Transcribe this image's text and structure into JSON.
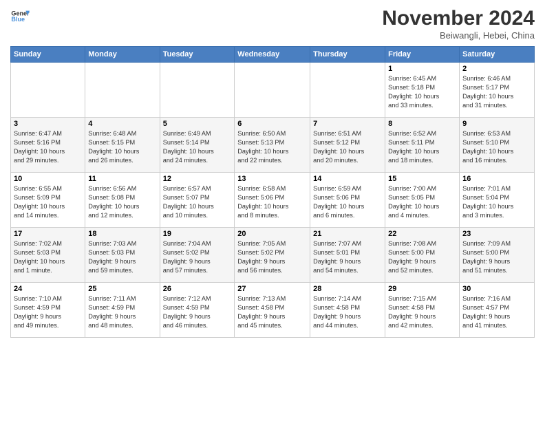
{
  "logo": {
    "line1": "General",
    "line2": "Blue"
  },
  "title": "November 2024",
  "location": "Beiwangli, Hebei, China",
  "weekdays": [
    "Sunday",
    "Monday",
    "Tuesday",
    "Wednesday",
    "Thursday",
    "Friday",
    "Saturday"
  ],
  "weeks": [
    [
      {
        "day": "",
        "info": ""
      },
      {
        "day": "",
        "info": ""
      },
      {
        "day": "",
        "info": ""
      },
      {
        "day": "",
        "info": ""
      },
      {
        "day": "",
        "info": ""
      },
      {
        "day": "1",
        "info": "Sunrise: 6:45 AM\nSunset: 5:18 PM\nDaylight: 10 hours\nand 33 minutes."
      },
      {
        "day": "2",
        "info": "Sunrise: 6:46 AM\nSunset: 5:17 PM\nDaylight: 10 hours\nand 31 minutes."
      }
    ],
    [
      {
        "day": "3",
        "info": "Sunrise: 6:47 AM\nSunset: 5:16 PM\nDaylight: 10 hours\nand 29 minutes."
      },
      {
        "day": "4",
        "info": "Sunrise: 6:48 AM\nSunset: 5:15 PM\nDaylight: 10 hours\nand 26 minutes."
      },
      {
        "day": "5",
        "info": "Sunrise: 6:49 AM\nSunset: 5:14 PM\nDaylight: 10 hours\nand 24 minutes."
      },
      {
        "day": "6",
        "info": "Sunrise: 6:50 AM\nSunset: 5:13 PM\nDaylight: 10 hours\nand 22 minutes."
      },
      {
        "day": "7",
        "info": "Sunrise: 6:51 AM\nSunset: 5:12 PM\nDaylight: 10 hours\nand 20 minutes."
      },
      {
        "day": "8",
        "info": "Sunrise: 6:52 AM\nSunset: 5:11 PM\nDaylight: 10 hours\nand 18 minutes."
      },
      {
        "day": "9",
        "info": "Sunrise: 6:53 AM\nSunset: 5:10 PM\nDaylight: 10 hours\nand 16 minutes."
      }
    ],
    [
      {
        "day": "10",
        "info": "Sunrise: 6:55 AM\nSunset: 5:09 PM\nDaylight: 10 hours\nand 14 minutes."
      },
      {
        "day": "11",
        "info": "Sunrise: 6:56 AM\nSunset: 5:08 PM\nDaylight: 10 hours\nand 12 minutes."
      },
      {
        "day": "12",
        "info": "Sunrise: 6:57 AM\nSunset: 5:07 PM\nDaylight: 10 hours\nand 10 minutes."
      },
      {
        "day": "13",
        "info": "Sunrise: 6:58 AM\nSunset: 5:06 PM\nDaylight: 10 hours\nand 8 minutes."
      },
      {
        "day": "14",
        "info": "Sunrise: 6:59 AM\nSunset: 5:06 PM\nDaylight: 10 hours\nand 6 minutes."
      },
      {
        "day": "15",
        "info": "Sunrise: 7:00 AM\nSunset: 5:05 PM\nDaylight: 10 hours\nand 4 minutes."
      },
      {
        "day": "16",
        "info": "Sunrise: 7:01 AM\nSunset: 5:04 PM\nDaylight: 10 hours\nand 3 minutes."
      }
    ],
    [
      {
        "day": "17",
        "info": "Sunrise: 7:02 AM\nSunset: 5:03 PM\nDaylight: 10 hours\nand 1 minute."
      },
      {
        "day": "18",
        "info": "Sunrise: 7:03 AM\nSunset: 5:03 PM\nDaylight: 9 hours\nand 59 minutes."
      },
      {
        "day": "19",
        "info": "Sunrise: 7:04 AM\nSunset: 5:02 PM\nDaylight: 9 hours\nand 57 minutes."
      },
      {
        "day": "20",
        "info": "Sunrise: 7:05 AM\nSunset: 5:02 PM\nDaylight: 9 hours\nand 56 minutes."
      },
      {
        "day": "21",
        "info": "Sunrise: 7:07 AM\nSunset: 5:01 PM\nDaylight: 9 hours\nand 54 minutes."
      },
      {
        "day": "22",
        "info": "Sunrise: 7:08 AM\nSunset: 5:00 PM\nDaylight: 9 hours\nand 52 minutes."
      },
      {
        "day": "23",
        "info": "Sunrise: 7:09 AM\nSunset: 5:00 PM\nDaylight: 9 hours\nand 51 minutes."
      }
    ],
    [
      {
        "day": "24",
        "info": "Sunrise: 7:10 AM\nSunset: 4:59 PM\nDaylight: 9 hours\nand 49 minutes."
      },
      {
        "day": "25",
        "info": "Sunrise: 7:11 AM\nSunset: 4:59 PM\nDaylight: 9 hours\nand 48 minutes."
      },
      {
        "day": "26",
        "info": "Sunrise: 7:12 AM\nSunset: 4:59 PM\nDaylight: 9 hours\nand 46 minutes."
      },
      {
        "day": "27",
        "info": "Sunrise: 7:13 AM\nSunset: 4:58 PM\nDaylight: 9 hours\nand 45 minutes."
      },
      {
        "day": "28",
        "info": "Sunrise: 7:14 AM\nSunset: 4:58 PM\nDaylight: 9 hours\nand 44 minutes."
      },
      {
        "day": "29",
        "info": "Sunrise: 7:15 AM\nSunset: 4:58 PM\nDaylight: 9 hours\nand 42 minutes."
      },
      {
        "day": "30",
        "info": "Sunrise: 7:16 AM\nSunset: 4:57 PM\nDaylight: 9 hours\nand 41 minutes."
      }
    ]
  ]
}
